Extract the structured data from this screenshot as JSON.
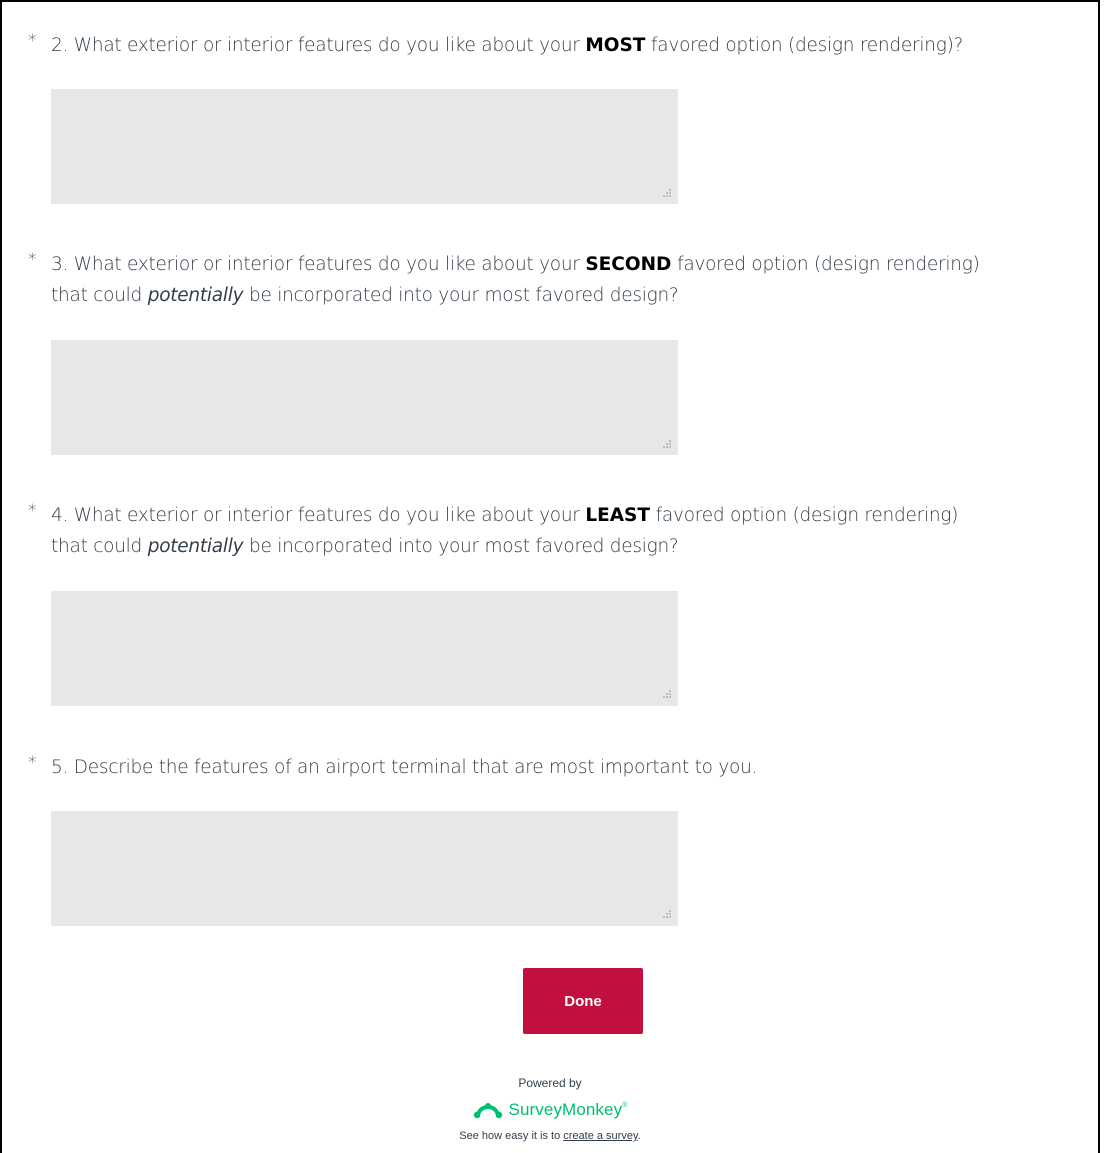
{
  "questions": [
    {
      "required_mark": "*",
      "number": "2.",
      "text_before": "What exterior or interior features do you like about your",
      "emphasis": "MOST",
      "text_after": "favored option (design rendering)?",
      "line2_before": "",
      "line2_italic": "",
      "line2_after": "",
      "answer": ""
    },
    {
      "required_mark": "*",
      "number": "3.",
      "text_before": "What exterior or interior features do you like about your",
      "emphasis": "SECOND",
      "text_after": "favored option (design rendering)",
      "line2_before": "that could",
      "line2_italic": "potentially",
      "line2_after": "be incorporated into your most favored design?",
      "answer": ""
    },
    {
      "required_mark": "*",
      "number": "4.",
      "text_before": "What exterior or interior features do you like about your",
      "emphasis": "LEAST",
      "text_after": "favored option (design rendering)",
      "line2_before": "that could",
      "line2_italic": "potentially",
      "line2_after": "be incorporated into your most favored design?",
      "answer": ""
    },
    {
      "required_mark": "*",
      "number": "5.",
      "text_before": "Describe the features of an airport terminal that are most important to you.",
      "emphasis": "",
      "text_after": "",
      "line2_before": "",
      "line2_italic": "",
      "line2_after": "",
      "answer": ""
    }
  ],
  "done_button": {
    "label": "Done",
    "color": "#c1103e"
  },
  "footer": {
    "powered_by": "Powered by",
    "brand": "SurveyMonkey",
    "brand_mark": "®",
    "brand_color": "#00bf6f",
    "brand_icon": "surveymonkey-logo-icon",
    "tagline_before": "See how easy it is to",
    "tagline_link": "create a survey",
    "tagline_after": "."
  }
}
